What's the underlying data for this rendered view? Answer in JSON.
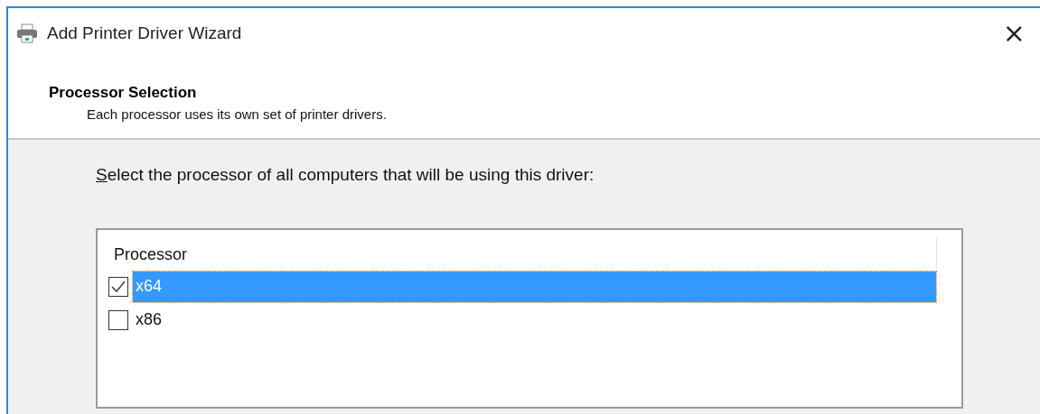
{
  "window": {
    "title": "Add Printer Driver Wizard",
    "close": "×"
  },
  "header": {
    "title": "Processor Selection",
    "subtitle": "Each processor uses its own set of printer drivers."
  },
  "prompt": "Select the processor of all computers that will be using this driver:",
  "list": {
    "columns": [
      "Processor"
    ],
    "rows": [
      {
        "label": "x64",
        "checked": true,
        "selected": true
      },
      {
        "label": "x86",
        "checked": false,
        "selected": false
      }
    ]
  }
}
